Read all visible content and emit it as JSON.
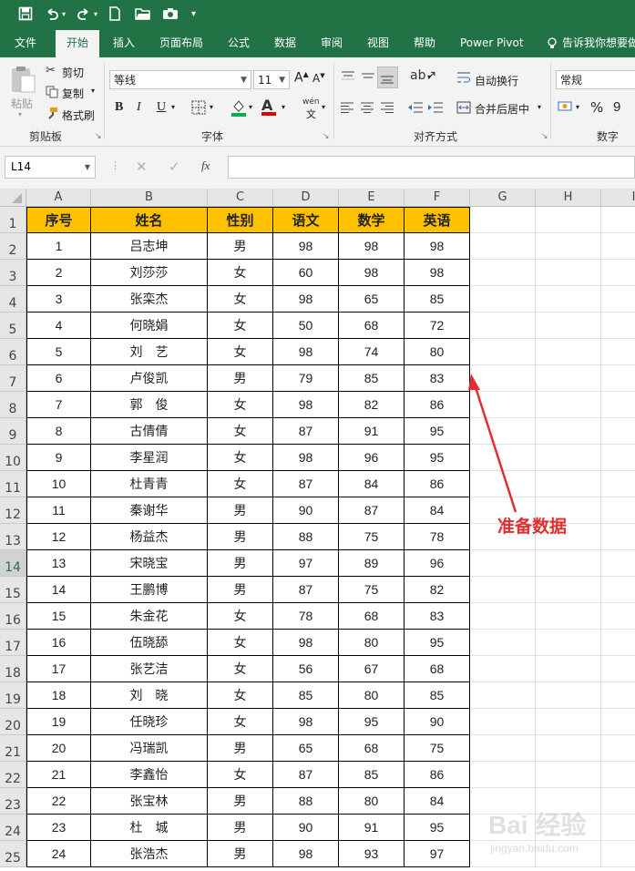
{
  "quick_access": {
    "save_icon": "save-icon",
    "undo_icon": "undo-icon",
    "redo_icon": "redo-icon",
    "new_icon": "new-file-icon",
    "open_icon": "open-folder-icon",
    "camera_icon": "camera-icon",
    "customize_icon": "customize-qat-icon"
  },
  "tabs": [
    "文件",
    "开始",
    "插入",
    "页面布局",
    "公式",
    "数据",
    "审阅",
    "视图",
    "帮助",
    "Power Pivot",
    "告诉我你想要做"
  ],
  "active_tab": "开始",
  "ribbon": {
    "clipboard": {
      "paste": "粘贴",
      "cut": "剪切",
      "copy": "复制",
      "format_painter": "格式刷",
      "group_label": "剪贴板"
    },
    "font": {
      "font_name": "等线",
      "font_size": "11",
      "bold": "B",
      "italic": "I",
      "underline": "U",
      "increase": "A",
      "decrease": "A",
      "phonetic": "wén",
      "group_label": "字体"
    },
    "alignment": {
      "wrap_text": "自动换行",
      "merge_center": "合并后居中",
      "group_label": "对齐方式"
    },
    "number": {
      "format": "常规",
      "percent": "%",
      "comma": "9",
      "group_label": "数字"
    }
  },
  "formula_bar": {
    "name_box": "L14",
    "fx": "fx",
    "value": ""
  },
  "sheet": {
    "columns": [
      "A",
      "B",
      "C",
      "D",
      "E",
      "F",
      "G",
      "H",
      "I"
    ],
    "rows": [
      "1",
      "2",
      "3",
      "4",
      "5",
      "6",
      "7",
      "8",
      "9",
      "10",
      "11",
      "12",
      "13",
      "14",
      "15",
      "16",
      "17",
      "18",
      "19",
      "20",
      "21",
      "22",
      "23",
      "24",
      "25"
    ],
    "header": [
      "序号",
      "姓名",
      "性别",
      "语文",
      "数学",
      "英语"
    ],
    "data": [
      [
        "1",
        "吕志坤",
        "男",
        "98",
        "98",
        "98"
      ],
      [
        "2",
        "刘莎莎",
        "女",
        "60",
        "98",
        "98"
      ],
      [
        "3",
        "张栾杰",
        "女",
        "98",
        "65",
        "85"
      ],
      [
        "4",
        "何晓娟",
        "女",
        "50",
        "68",
        "72"
      ],
      [
        "5",
        "刘　艺",
        "女",
        "98",
        "74",
        "80"
      ],
      [
        "6",
        "卢俊凯",
        "男",
        "79",
        "85",
        "83"
      ],
      [
        "7",
        "郭　俊",
        "女",
        "98",
        "82",
        "86"
      ],
      [
        "8",
        "古倩倩",
        "女",
        "87",
        "91",
        "95"
      ],
      [
        "9",
        "李星润",
        "女",
        "98",
        "96",
        "95"
      ],
      [
        "10",
        "杜青青",
        "女",
        "87",
        "84",
        "86"
      ],
      [
        "11",
        "秦谢华",
        "男",
        "90",
        "87",
        "84"
      ],
      [
        "12",
        "杨益杰",
        "男",
        "88",
        "75",
        "78"
      ],
      [
        "13",
        "宋晓宝",
        "男",
        "97",
        "89",
        "96"
      ],
      [
        "14",
        "王鹏博",
        "男",
        "87",
        "75",
        "82"
      ],
      [
        "15",
        "朱金花",
        "女",
        "78",
        "68",
        "83"
      ],
      [
        "16",
        "伍晓舔",
        "女",
        "98",
        "80",
        "95"
      ],
      [
        "17",
        "张艺洁",
        "女",
        "56",
        "67",
        "68"
      ],
      [
        "18",
        "刘　晓",
        "女",
        "85",
        "80",
        "85"
      ],
      [
        "19",
        "任晓珍",
        "女",
        "98",
        "95",
        "90"
      ],
      [
        "20",
        "冯瑞凯",
        "男",
        "65",
        "68",
        "75"
      ],
      [
        "21",
        "李鑫怡",
        "女",
        "87",
        "85",
        "86"
      ],
      [
        "22",
        "张宝林",
        "男",
        "88",
        "80",
        "84"
      ],
      [
        "23",
        "杜　城",
        "男",
        "90",
        "91",
        "95"
      ],
      [
        "24",
        "张浩杰",
        "男",
        "98",
        "93",
        "97"
      ]
    ]
  },
  "annotation": {
    "label": "准备数据",
    "color": "#e03030"
  },
  "watermark": {
    "logo": "Bai 经验",
    "url": "jingyan.baidu.com"
  },
  "colors": {
    "excel_green": "#217346",
    "header_fill": "#ffc000"
  }
}
